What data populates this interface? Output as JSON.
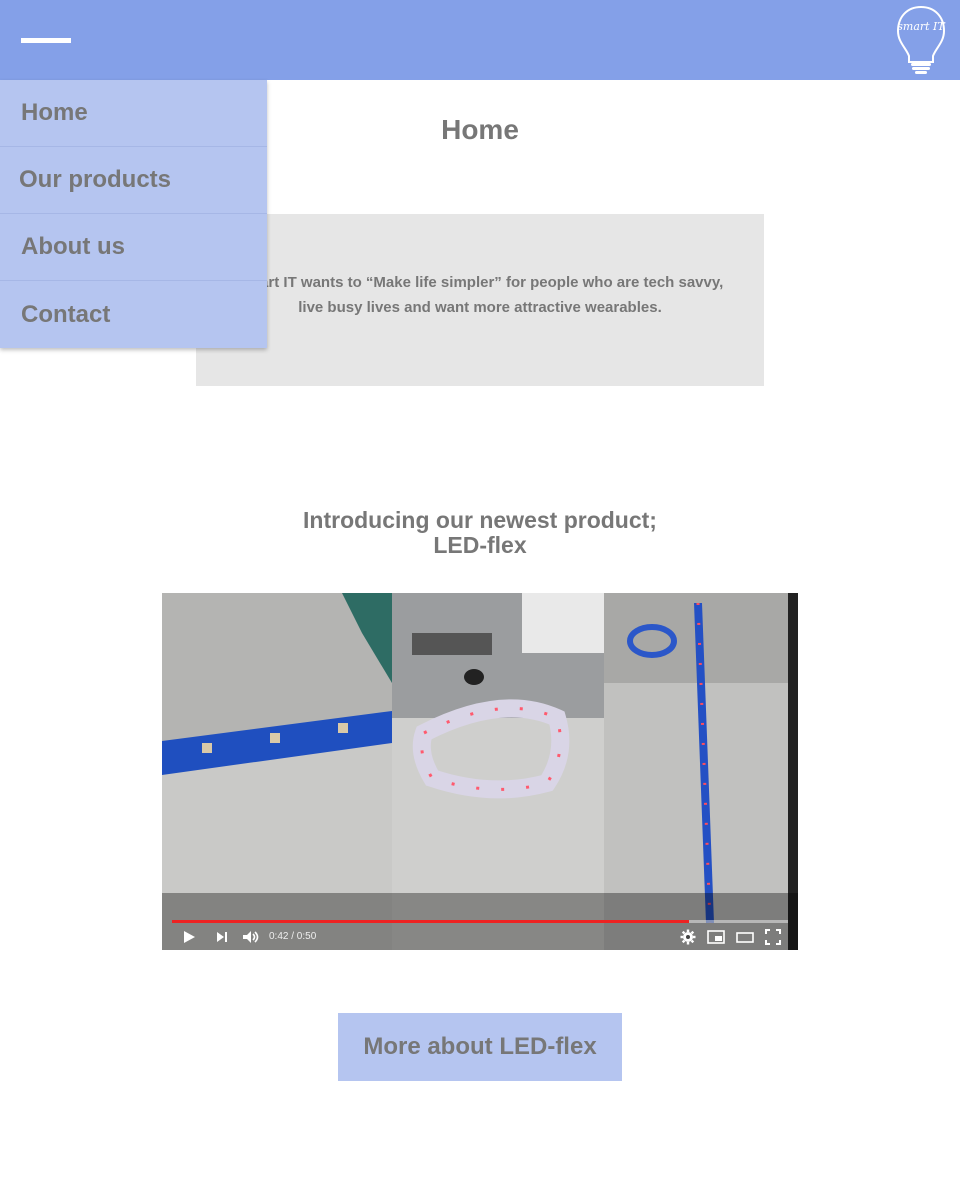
{
  "header": {
    "menu_icon": "hamburger-icon",
    "logo_text": "smart IT",
    "logo_icon": "lightbulb-logo"
  },
  "nav": {
    "items": [
      {
        "label": "Home"
      },
      {
        "label": "Our products"
      },
      {
        "label": "About us"
      },
      {
        "label": "Contact"
      }
    ]
  },
  "main": {
    "title": "Home",
    "mission_line1": "Smart IT wants to “Make life simpler” for people who are tech savvy,",
    "mission_line2": "live busy lives and want more attractive wearables.",
    "product_heading_line1": "Introducing our newest product;",
    "product_heading_line2": "LED-flex",
    "more_button": "More about LED-flex"
  },
  "video": {
    "time": "0:42 / 0:50",
    "progress": 0.84,
    "controls": [
      "play-icon",
      "next-icon",
      "volume-icon",
      "settings-icon",
      "miniplayer-icon",
      "theater-icon",
      "fullscreen-icon"
    ]
  },
  "colors": {
    "header": "#84a0e8",
    "nav": "#b5c5f0",
    "mission_box": "#e6e6e6",
    "progress": "#ee2222"
  }
}
